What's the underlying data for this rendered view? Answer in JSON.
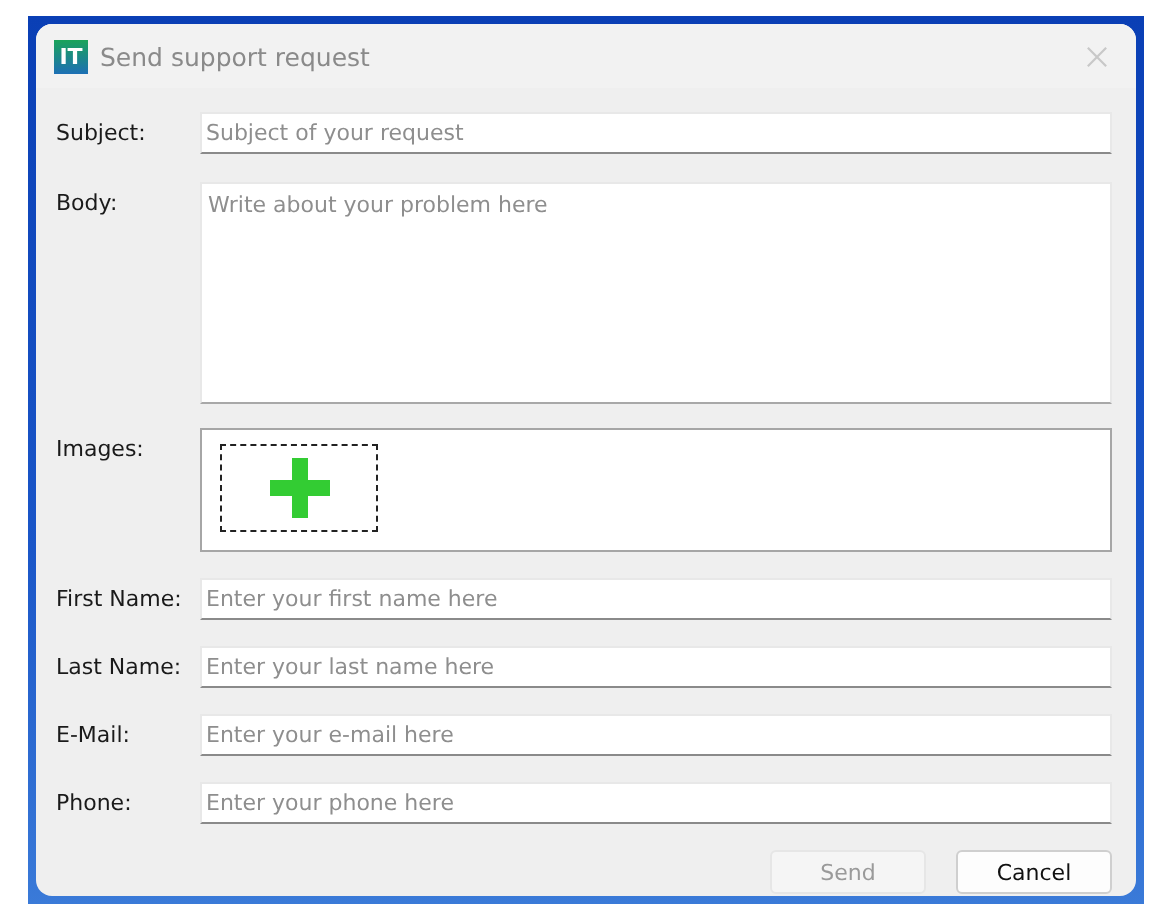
{
  "window": {
    "title": "Send support request",
    "logo": "IT"
  },
  "fields": [
    {
      "kind": "line",
      "label": "Subject:",
      "placeholder": "Subject of your request"
    },
    {
      "kind": "area",
      "label": "Body:",
      "placeholder": "Write about your problem here"
    },
    {
      "kind": "images",
      "label": "Images:"
    },
    {
      "kind": "line",
      "label": "First Name:",
      "placeholder": "Enter your first name here"
    },
    {
      "kind": "line",
      "label": "Last Name:",
      "placeholder": "Enter your last name here"
    },
    {
      "kind": "line",
      "label": "E-Mail:",
      "placeholder": "Enter your e-mail here"
    },
    {
      "kind": "line",
      "label": "Phone:",
      "placeholder": "Enter your phone here"
    }
  ],
  "buttons": [
    {
      "label": "Send",
      "disabled": true
    },
    {
      "label": "Cancel",
      "disabled": false
    }
  ]
}
